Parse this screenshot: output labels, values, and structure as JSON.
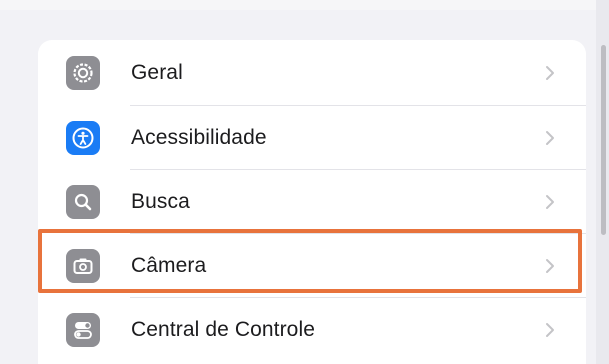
{
  "settings": {
    "items": [
      {
        "label": "Geral",
        "icon": "gear-icon",
        "icon_color": "#8e8e93"
      },
      {
        "label": "Acessibilidade",
        "icon": "accessibility-icon",
        "icon_color": "#1a7cf5"
      },
      {
        "label": "Busca",
        "icon": "search-icon",
        "icon_color": "#8e8e93"
      },
      {
        "label": "Câmera",
        "icon": "camera-icon",
        "icon_color": "#8e8e93"
      },
      {
        "label": "Central de Controle",
        "icon": "control-center-icon",
        "icon_color": "#8e8e93"
      }
    ],
    "highlighted_item": "Câmera",
    "highlight_color": "#e8733c"
  }
}
